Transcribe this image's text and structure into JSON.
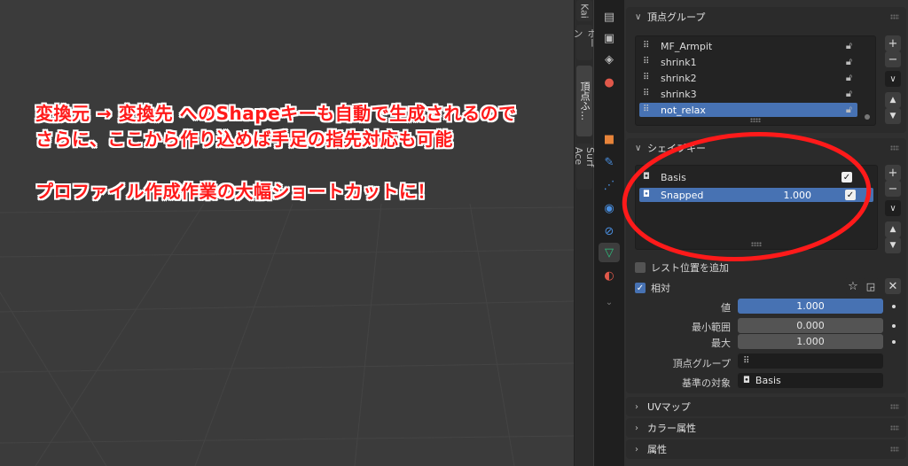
{
  "side_tabs": [
    "Kai",
    "ボーン",
    "頂点ふ…",
    "Surf Ace"
  ],
  "prop_tabs": [
    "render-icon",
    "output-icon",
    "view-layer-icon",
    "scene-icon",
    "world-icon",
    "object-icon",
    "modifier-icon",
    "particles-icon",
    "physics-icon",
    "constraints-icon",
    "data-icon",
    "material-icon"
  ],
  "vertex_groups": {
    "title": "頂点グループ",
    "items": [
      "MF_Armpit",
      "shrink1",
      "shrink2",
      "shrink3",
      "not_relax"
    ],
    "selected_index": 4
  },
  "shape_keys": {
    "title": "シェイプキー",
    "items": [
      {
        "name": "Basis",
        "value": "",
        "checked": true
      },
      {
        "name": "Snapped",
        "value": "1.000",
        "checked": true
      }
    ],
    "selected_index": 1,
    "rest_position_label": "レスト位置を追加",
    "relative_label": "相対",
    "value_label": "値",
    "value": "1.000",
    "range_min_label": "最小範囲",
    "range_min": "0.000",
    "max_label": "最大",
    "max": "1.000",
    "vgroup_label": "頂点グループ",
    "relative_to_label": "基準の対象",
    "relative_to": "Basis"
  },
  "collapsed_panels": [
    "UVマップ",
    "カラー属性",
    "属性"
  ],
  "annotation": {
    "line1": "変換元 → 変換先 へのShapeキーも自動で生成されるので",
    "line2": "さらに、ここから作り込めば手足の指先対応も可能",
    "line3": "プロファイル作成作業の大幅ショートカットに！",
    "color": "#ff1a1a"
  },
  "colors": {
    "accent": "#4772b3",
    "panel": "#2b2b2b",
    "viewport": "#3b3b3b"
  }
}
